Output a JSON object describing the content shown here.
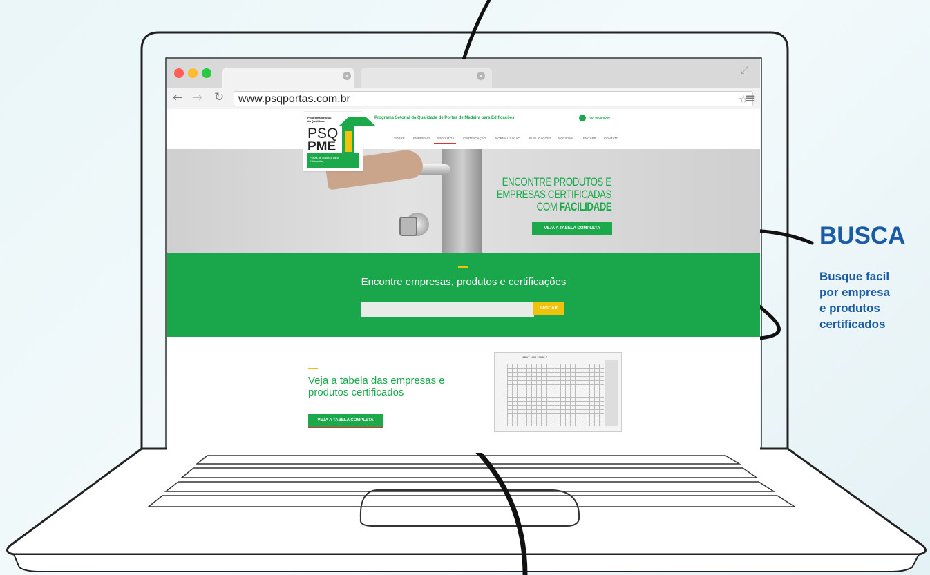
{
  "browser": {
    "url": "www.psqportas.com.br"
  },
  "site": {
    "logo": {
      "small_text": "Programa Setorial da Qualidade",
      "line1": "PSQ",
      "line2": "PME",
      "bottom_text": "Portas de Madeira para Edificações"
    },
    "title": "Programa Setorial da Qualidade de Portas de Madeira para Edificações",
    "phone": "(00) 0000-0000",
    "menu": [
      "SOBRE",
      "EMPRESAS",
      "PRODUTOS",
      "CERTIFICAÇÃO",
      "NORMALIZAÇÃO",
      "PUBLICAÇÕES",
      "NOTÍCIAS",
      "ENCAPP",
      "CONTATO"
    ],
    "hero": {
      "line1": "ENCONTRE PRODUTOS E",
      "line2": "EMPRESAS CERTIFICADAS",
      "line3_prefix": "COM ",
      "line3_bold": "FACILIDADE",
      "button": "VEJA A TABELA COMPLETA"
    },
    "search": {
      "title": "Encontre empresas, produtos e certificações",
      "input_value": "",
      "button": "BUSCAR"
    },
    "table_section": {
      "title": "Veja a tabela das empresas e produtos certificados",
      "button": "VEJA A TABELA COMPLETA",
      "thumb_caption": "ABNT NBR 15930-2"
    }
  },
  "annotation": {
    "title": "BUSCA",
    "text": "Busque facil\npor empresa\ne produtos\ncertificados"
  },
  "colors": {
    "brand_green": "#1ba94c",
    "accent_yellow": "#f1c20c",
    "annotation_blue": "#1a5ba6"
  }
}
